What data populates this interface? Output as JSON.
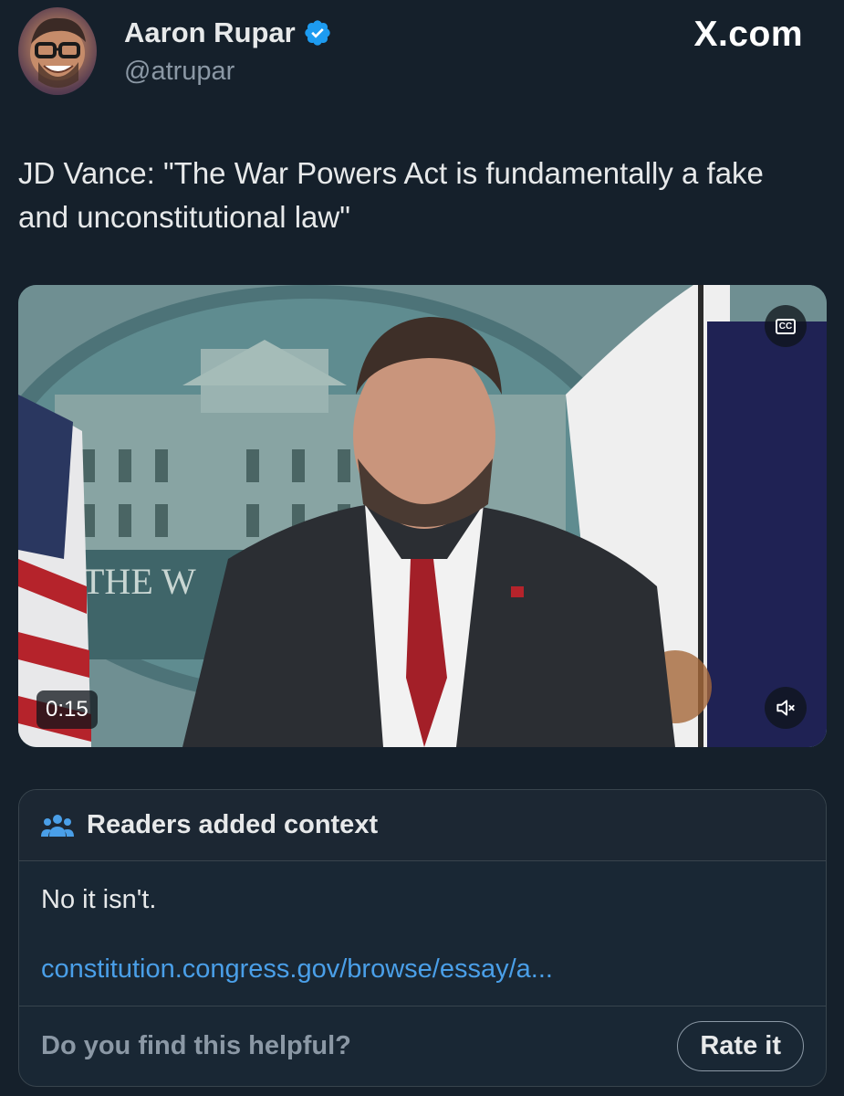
{
  "author": {
    "name": "Aaron Rupar",
    "handle": "@atrupar",
    "verified": true,
    "verified_color": "#1d9bf0"
  },
  "brand": "X.com",
  "tweet": {
    "text": "JD Vance: \"The War Powers Act is fundamentally a fake and unconstitutional law\""
  },
  "video": {
    "duration": "0:15",
    "cc_label": "CC",
    "cc_icon": "closed-captions-icon",
    "mute_icon": "volume-muted-icon"
  },
  "community_note": {
    "title": "Readers added context",
    "title_icon": "people-icon",
    "body": "No it isn't.",
    "link": "constitution.congress.gov/browse/essay/a...",
    "link_color": "#4a9fe8",
    "helpful_prompt": "Do you find this helpful?",
    "rate_label": "Rate it"
  }
}
